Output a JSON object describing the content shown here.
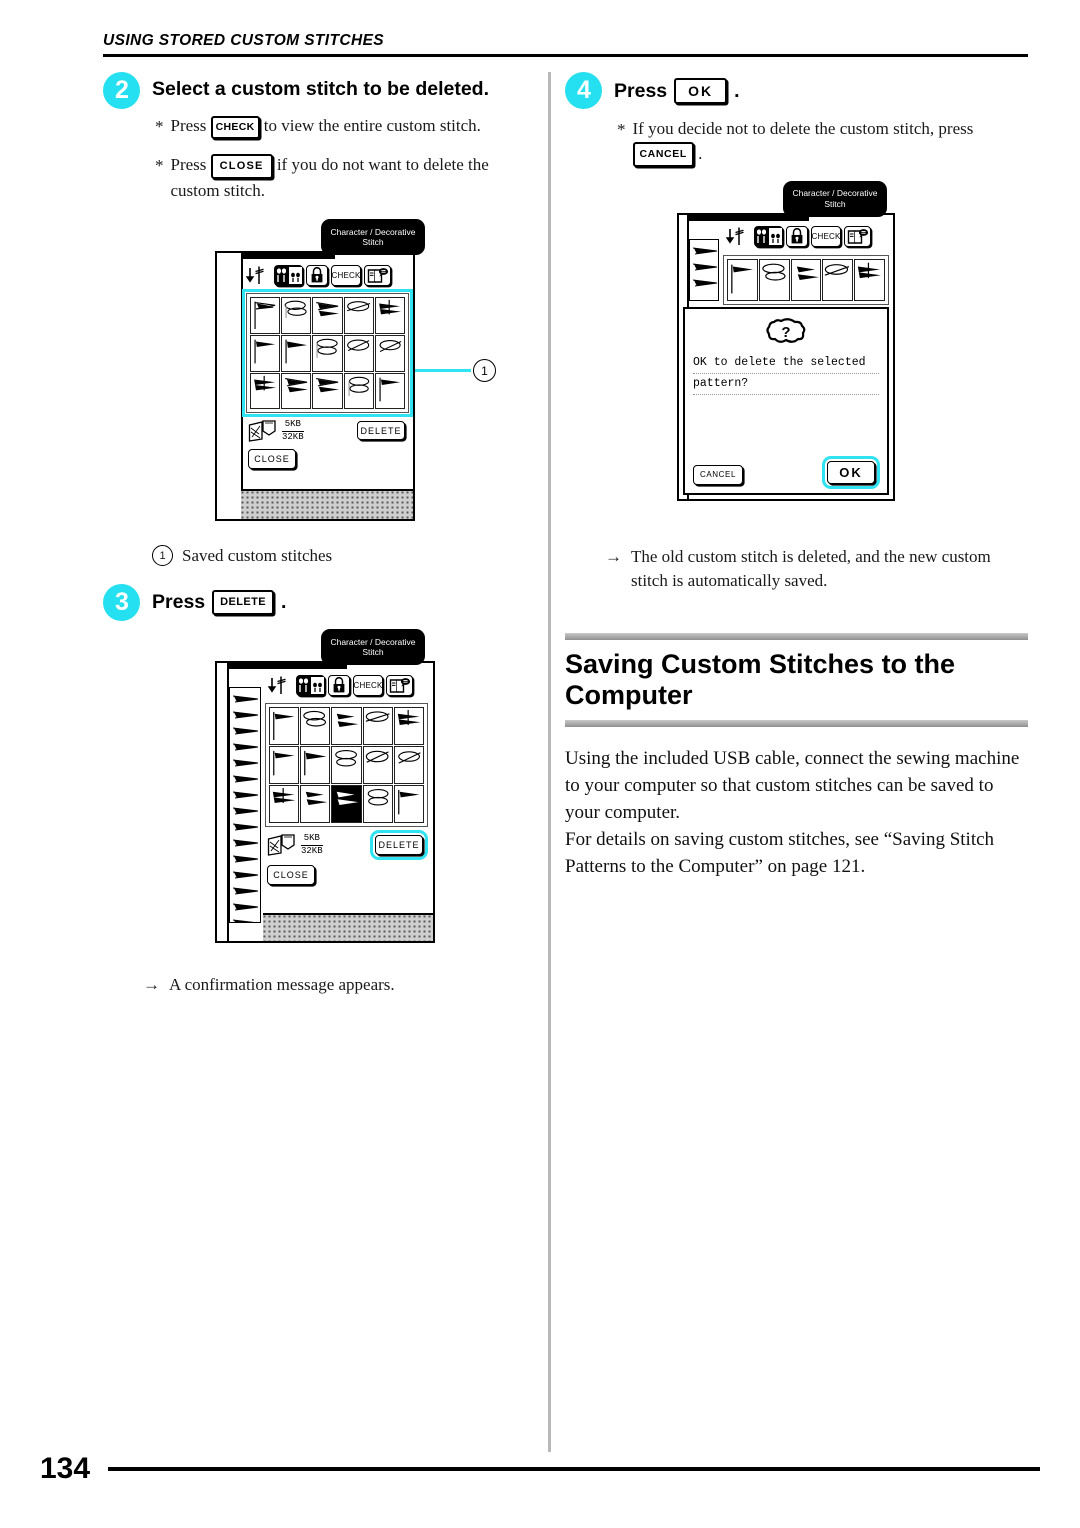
{
  "running_head": "USING STORED CUSTOM STITCHES",
  "page_number": "134",
  "accent_color": "#25E0F0",
  "steps": {
    "step2": {
      "number": "2",
      "title": "Select a custom stitch to be deleted.",
      "notes": [
        {
          "star": "*",
          "pre": "Press",
          "key": "CHECK",
          "post": "to view the entire custom stitch."
        },
        {
          "star": "*",
          "pre": "Press",
          "key": "CLOSE",
          "post": "if you do not want to delete the custom stitch."
        }
      ],
      "callout": {
        "marker": "1",
        "label": "Saved custom stitches"
      }
    },
    "step3": {
      "number": "3",
      "pre_label": "Press",
      "key": "DELETE",
      "post_label": ".",
      "result": {
        "arrow": "→",
        "text": "A confirmation message appears."
      }
    },
    "step4": {
      "number": "4",
      "pre_label": "Press",
      "key": "OK",
      "post_label": ".",
      "note": {
        "star": "*",
        "pre": "If you decide not to delete the custom stitch, press",
        "key": "CANCEL",
        "post": "."
      },
      "result": {
        "arrow": "→",
        "text": "The old custom stitch is deleted, and the new custom stitch is automatically saved."
      }
    }
  },
  "lcd": {
    "tab_title_line1": "Character / Decorative",
    "tab_title_line2": "Stitch",
    "toolbar": {
      "needle_icon": "needle-position-icon",
      "twin_icon": "twin-needle-icon",
      "lock_icon": "lock-icon",
      "check_label": "CHECK",
      "guide_icon": "manual-guide-icon"
    },
    "memory": {
      "icon": "memory-pocket-icon",
      "used": "5KB",
      "total": "32KB"
    },
    "delete_label": "DELETE",
    "close_label": "CLOSE"
  },
  "dialog": {
    "icon": "question-mark-icon",
    "message_line1": "OK to delete the selected",
    "message_line2": "pattern?",
    "cancel_label": "CANCEL",
    "ok_label": "OK"
  },
  "section": {
    "heading_line1": "Saving Custom Stitches to the",
    "heading_line2": "Computer",
    "paragraph1": "Using the included USB cable, connect the sewing machine to your computer so that custom stitches can be saved to your computer.",
    "paragraph2": "For details on saving custom stitches,  see “Saving Stitch Patterns to the Computer” on page 121."
  }
}
